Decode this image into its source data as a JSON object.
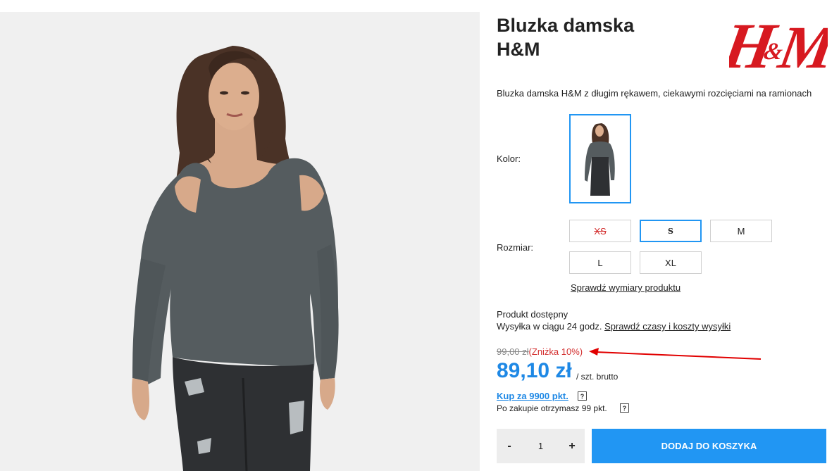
{
  "product": {
    "title_line1": "Bluzka damska",
    "title_line2": "H&M",
    "brand_logo_text": "H&M",
    "description": "Bluzka damska H&M z długim rękawem, ciekawymi rozcięciami na ramionach",
    "image_icon": "product-photo"
  },
  "color": {
    "label": "Kolor:"
  },
  "size": {
    "label": "Rozmiar:",
    "options": [
      {
        "label": "XS",
        "state": "unavailable"
      },
      {
        "label": "S",
        "state": "selected"
      },
      {
        "label": "M",
        "state": "available"
      },
      {
        "label": "L",
        "state": "available"
      },
      {
        "label": "XL",
        "state": "available"
      }
    ],
    "chart_link": "Sprawdź wymiary produktu"
  },
  "availability": {
    "status": "Produkt dostępny",
    "shipping_text": "Wysyłka w ciągu 24 godz.",
    "shipping_link": "Sprawdź czasy i koszty wysyłki"
  },
  "price": {
    "old": "99,00 zł",
    "discount": "(Zniżka 10%)",
    "current": "89,10 zł",
    "unit": "/ szt. brutto"
  },
  "points": {
    "buy_link": "Kup za 9900 pkt.",
    "info": "Po zakupie otrzymasz 99 pkt.",
    "help": "?"
  },
  "cart": {
    "minus": "-",
    "quantity": "1",
    "plus": "+",
    "add_label": "DODAJ DO KOSZYKA"
  },
  "colors": {
    "accent": "#2196f3",
    "price": "#1e88e5",
    "brand": "#d71920",
    "discount": "#d32f2f"
  }
}
